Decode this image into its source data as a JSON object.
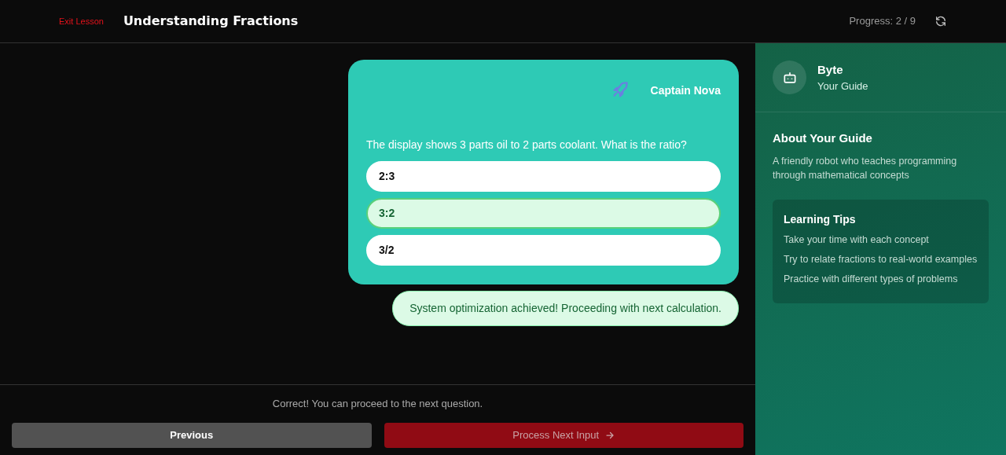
{
  "header": {
    "exit_link": "Exit Lesson",
    "title": "Understanding Fractions",
    "progress": "Progress: 2 / 9"
  },
  "question_card": {
    "character": "Captain Nova",
    "question": "The display shows 3 parts oil to 2 parts coolant. What is the ratio?",
    "options": [
      {
        "label": "2:3",
        "selected": false
      },
      {
        "label": "3:2",
        "selected": true
      },
      {
        "label": "3/2",
        "selected": false
      }
    ]
  },
  "feedback_bubble": "System optimization achieved! Proceeding with next calculation.",
  "footer": {
    "status": "Correct! You can proceed to the next question.",
    "previous_button": "Previous",
    "next_button": "Process Next Input"
  },
  "guide": {
    "name": "Byte",
    "role": "Your Guide",
    "about_title": "About Your Guide",
    "about_text": "A friendly robot who teaches programming through mathematical concepts",
    "tips_title": "Learning Tips",
    "tips": [
      "Take your time with each concept",
      "Try to relate fractions to real-world examples",
      "Practice with different types of problems"
    ]
  }
}
